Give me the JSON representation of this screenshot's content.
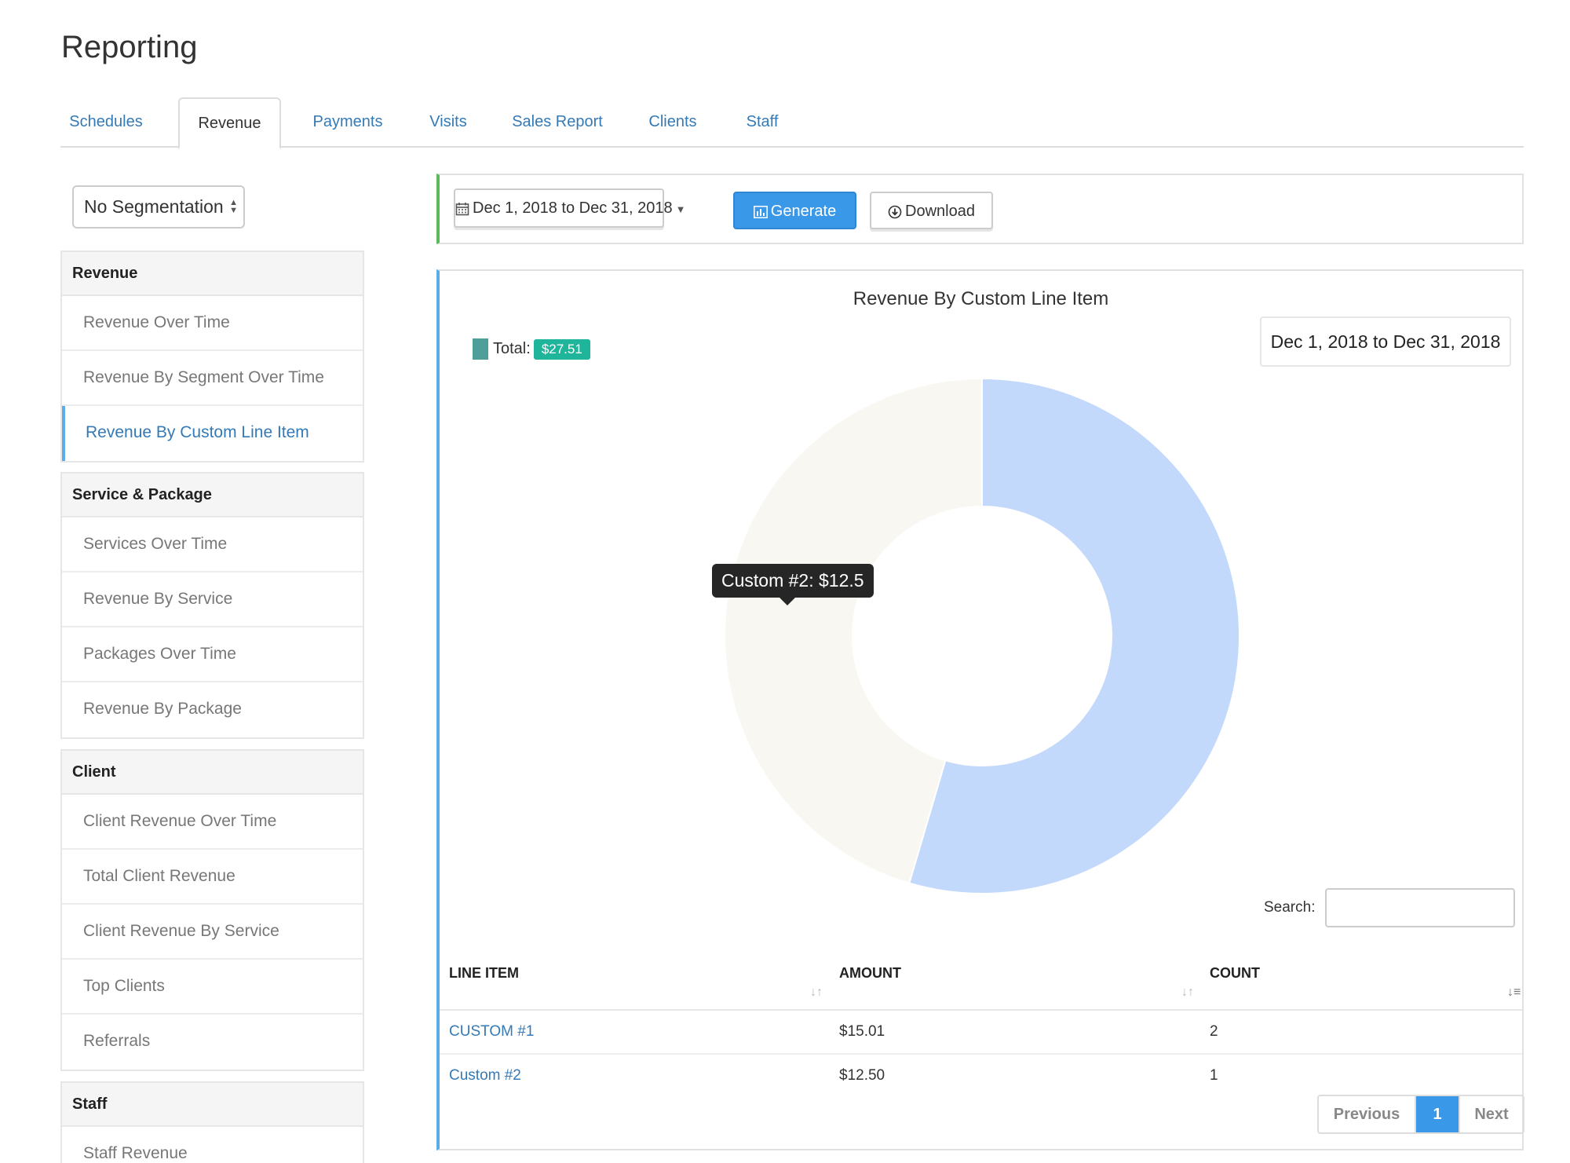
{
  "page": {
    "title": "Reporting"
  },
  "tabs": [
    {
      "label": "Schedules"
    },
    {
      "label": "Revenue"
    },
    {
      "label": "Payments"
    },
    {
      "label": "Visits"
    },
    {
      "label": "Sales Report"
    },
    {
      "label": "Clients"
    },
    {
      "label": "Staff"
    }
  ],
  "active_tab": "Revenue",
  "sidebar": {
    "segmentation": "No Segmentation",
    "groups": [
      {
        "title": "Revenue",
        "items": [
          "Revenue Over Time",
          "Revenue By Segment Over Time",
          "Revenue By Custom Line Item"
        ]
      },
      {
        "title": "Service & Package",
        "items": [
          "Services Over Time",
          "Revenue By Service",
          "Packages Over Time",
          "Revenue By Package"
        ]
      },
      {
        "title": "Client",
        "items": [
          "Client Revenue Over Time",
          "Total Client Revenue",
          "Client Revenue By Service",
          "Top Clients",
          "Referrals"
        ]
      },
      {
        "title": "Staff",
        "items": [
          "Staff Revenue"
        ]
      }
    ],
    "active_item": "Revenue By Custom Line Item"
  },
  "toolbar": {
    "date_range": "Dec 1, 2018 to Dec 31, 2018",
    "generate_label": "Generate",
    "download_label": "Download"
  },
  "report": {
    "legend_label": "Total:",
    "legend_total": "$27.51",
    "date_badge": "Dec 1, 2018 to Dec 31, 2018",
    "tooltip": "Custom #2: $12.5",
    "search_label": "Search:",
    "search_value": ""
  },
  "chart_data": {
    "type": "pie",
    "title": "Revenue By Custom Line Item",
    "categories": [
      "CUSTOM #1",
      "Custom #2"
    ],
    "values": [
      15.01,
      12.5
    ],
    "colors": [
      "#c3d9fc",
      "#f9f7f1"
    ],
    "donut": true
  },
  "table": {
    "columns": [
      "LINE ITEM",
      "AMOUNT",
      "COUNT"
    ],
    "rows": [
      [
        "CUSTOM #1",
        "$15.01",
        "2"
      ],
      [
        "Custom #2",
        "$12.50",
        "1"
      ]
    ]
  },
  "pagination": {
    "previous": "Previous",
    "current": "1",
    "next": "Next"
  }
}
